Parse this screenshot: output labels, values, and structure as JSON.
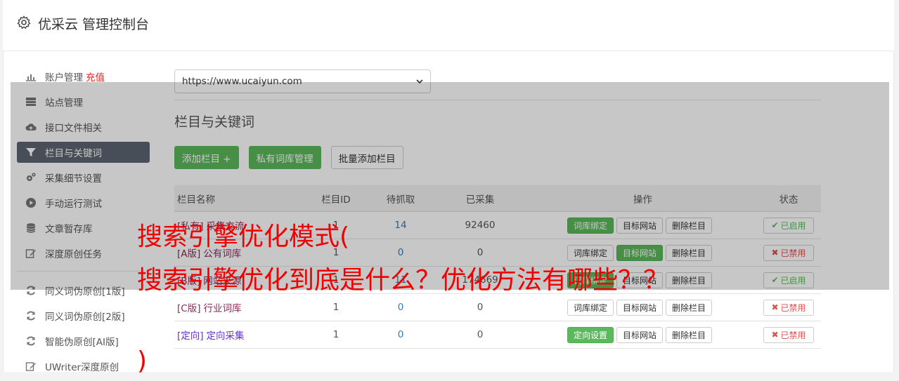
{
  "header": {
    "title": "优采云 管理控制台",
    "icon": "gear-icon"
  },
  "sidebar": {
    "items": [
      {
        "label": "账户管理",
        "accent": "充值",
        "icon": "bar-chart-icon"
      },
      {
        "label": "站点管理",
        "icon": "server-icon"
      },
      {
        "label": "接口文件相关",
        "icon": "cloud-upload-icon"
      },
      {
        "label": "栏目与关键词",
        "icon": "filter-icon",
        "active": true
      },
      {
        "label": "采集细节设置",
        "icon": "cogs-icon"
      },
      {
        "label": "手动运行测试",
        "icon": "play-circle-icon"
      },
      {
        "label": "文章暂存库",
        "icon": "database-icon"
      },
      {
        "label": "深度原创任务",
        "icon": "edit-icon"
      }
    ],
    "items2": [
      {
        "label": "同义词伪原创[1版]",
        "icon": "refresh-icon"
      },
      {
        "label": "同义词伪原创[2版]",
        "icon": "refresh-icon"
      },
      {
        "label": "智能伪原创[AI版]",
        "icon": "refresh-icon"
      },
      {
        "label": "UWriter深度原创",
        "icon": "edit-icon"
      }
    ]
  },
  "main": {
    "site_select": "https://www.ucaiyun.com",
    "section_title": "栏目与关键词",
    "buttons": {
      "add": "添加栏目 +",
      "private": "私有词库管理",
      "batch": "批量添加栏目"
    },
    "columns": [
      "栏目名称",
      "栏目ID",
      "待抓取",
      "已采集",
      "操作",
      "状态"
    ],
    "rows": [
      {
        "tag": "[私有]",
        "name": "采集交流",
        "id": "1",
        "pending": "14",
        "collected": "92460",
        "op1": "词库绑定",
        "op1_green": true,
        "op2": "目标网站",
        "op2_green": false,
        "op3": "删除栏目",
        "status": "已启用",
        "on": true
      },
      {
        "tag": "[A版]",
        "name": "公有词库",
        "id": "1",
        "pending": "0",
        "collected": "0",
        "op1": "词库绑定",
        "op1_green": false,
        "op2": "目标网站",
        "op2_green": true,
        "op3": "删除栏目",
        "status": "已禁用",
        "on": false
      },
      {
        "tag": "[B版]",
        "name": "网站来源",
        "id": "1",
        "pending": "11",
        "collected": "174669",
        "op1": "词库绑定",
        "op1_green": true,
        "op2": "目标网站",
        "op2_green": false,
        "op3": "删除栏目",
        "status": "已启用",
        "on": true
      },
      {
        "tag": "[C版]",
        "name": "行业词库",
        "id": "1",
        "pending": "0",
        "collected": "0",
        "op1": "词库绑定",
        "op1_green": false,
        "op2": "目标网站",
        "op2_green": false,
        "op3": "删除栏目",
        "status": "已禁用",
        "on": false
      },
      {
        "tag": "[定向]",
        "name": "定向采集",
        "id": "1",
        "pending": "0",
        "collected": "0",
        "op1": "定向设置",
        "op1_green": true,
        "op2": "目标网站",
        "op2_green": false,
        "op3": "删除栏目",
        "status": "已禁用",
        "on": false,
        "directed": true
      }
    ]
  },
  "overlay_text": {
    "line1": "搜索引擎优化模式(",
    "line2": "搜索引擎优化到底是什么？优化方法有哪些？？",
    "line3": ")"
  },
  "colors": {
    "green": "#5cb85c",
    "sidebar_active": "#5b6570",
    "overlay_red": "#f00000"
  }
}
